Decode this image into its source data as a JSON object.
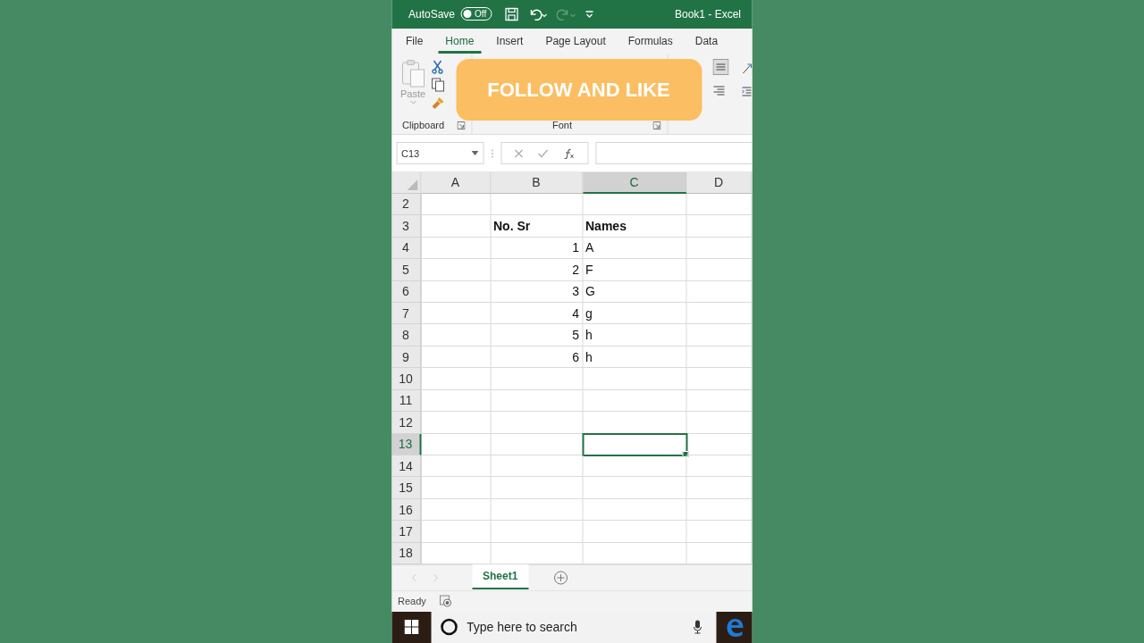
{
  "title_bar": {
    "autosave_label": "AutoSave",
    "autosave_toggle": {
      "label": "Off",
      "on": false
    },
    "document_title": "Book1  -  Excel"
  },
  "tabs": [
    {
      "label": "File",
      "selected": false
    },
    {
      "label": "Home",
      "selected": true
    },
    {
      "label": "Insert",
      "selected": false
    },
    {
      "label": "Page Layout",
      "selected": false
    },
    {
      "label": "Formulas",
      "selected": false
    },
    {
      "label": "Data",
      "selected": false
    }
  ],
  "ribbon": {
    "paste_label": "Paste",
    "groups": [
      "Clipboard",
      "Font"
    ]
  },
  "banner": {
    "text": "FOLLOW AND LIKE"
  },
  "name_box": "C13",
  "columns": [
    {
      "label": "A",
      "selected": false
    },
    {
      "label": "B",
      "selected": false
    },
    {
      "label": "C",
      "selected": true
    },
    {
      "label": "D",
      "selected": false
    }
  ],
  "rows": [
    {
      "number": "2",
      "selected": false
    },
    {
      "number": "3",
      "selected": false,
      "cells": [
        null,
        {
          "text": "No. Sr",
          "kind": "header"
        },
        {
          "text": "Names",
          "kind": "header"
        },
        null
      ]
    },
    {
      "number": "4",
      "selected": false,
      "cells": [
        null,
        {
          "text": "1",
          "kind": "number"
        },
        {
          "text": "A",
          "kind": "text"
        },
        null
      ]
    },
    {
      "number": "5",
      "selected": false,
      "cells": [
        null,
        {
          "text": "2",
          "kind": "number"
        },
        {
          "text": "F",
          "kind": "text"
        },
        null
      ]
    },
    {
      "number": "6",
      "selected": false,
      "cells": [
        null,
        {
          "text": "3",
          "kind": "number"
        },
        {
          "text": "G",
          "kind": "text"
        },
        null
      ]
    },
    {
      "number": "7",
      "selected": false,
      "cells": [
        null,
        {
          "text": "4",
          "kind": "number"
        },
        {
          "text": "g",
          "kind": "text"
        },
        null
      ]
    },
    {
      "number": "8",
      "selected": false,
      "cells": [
        null,
        {
          "text": "5",
          "kind": "number"
        },
        {
          "text": "h",
          "kind": "text"
        },
        null
      ]
    },
    {
      "number": "9",
      "selected": false,
      "cells": [
        null,
        {
          "text": "6",
          "kind": "number"
        },
        {
          "text": "h",
          "kind": "text"
        },
        null
      ]
    },
    {
      "number": "10",
      "selected": false
    },
    {
      "number": "11",
      "selected": false
    },
    {
      "number": "12",
      "selected": false
    },
    {
      "number": "13",
      "selected": true
    },
    {
      "number": "14",
      "selected": false
    },
    {
      "number": "15",
      "selected": false
    },
    {
      "number": "16",
      "selected": false
    },
    {
      "number": "17",
      "selected": false
    },
    {
      "number": "18",
      "selected": false
    }
  ],
  "sheet_tabs": [
    {
      "label": "Sheet1",
      "selected": true
    }
  ],
  "status_bar": {
    "status": "Ready"
  },
  "taskbar": {
    "search_placeholder": "Type here to search"
  }
}
